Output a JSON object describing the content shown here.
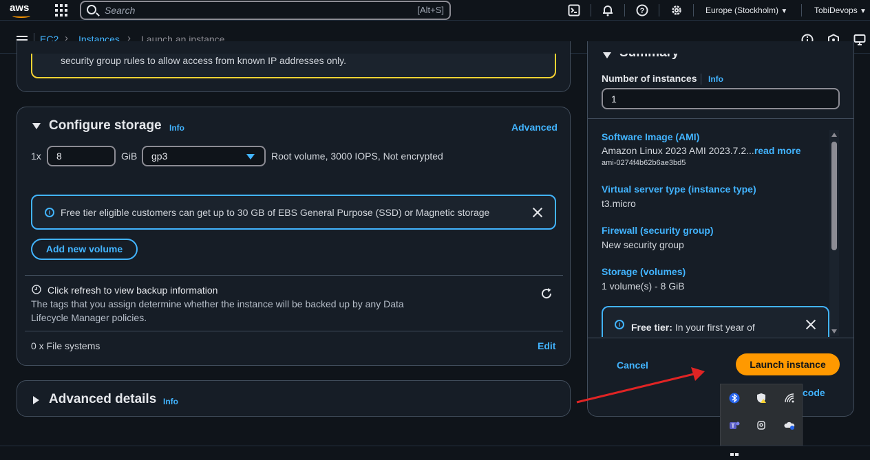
{
  "topbar": {
    "logo": "aws",
    "search_placeholder": "Search",
    "search_shortcut": "[Alt+S]",
    "region": "Europe (Stockholm)",
    "account": "TobiDevops",
    "icons": [
      "grid-icon",
      "cloudshell-icon",
      "bell-icon",
      "help-icon",
      "gear-icon"
    ]
  },
  "breadcrumb": {
    "items": [
      "EC2",
      "Instances"
    ],
    "current": "Launch an instance"
  },
  "network_warning": {
    "text": "security group rules to allow access from known IP addresses only."
  },
  "storage": {
    "title": "Configure storage",
    "info": "Info",
    "advanced": "Advanced",
    "multiplier": "1x",
    "size": "8",
    "unit": "GiB",
    "volume_type": "gp3",
    "details": "Root volume,  3000 IOPS,  Not encrypted",
    "alert": "Free tier eligible customers can get up to 30 GB of EBS General Purpose (SSD) or Magnetic storage",
    "add_volume": "Add new volume",
    "backup_title": "Click refresh to view backup information",
    "backup_desc_1": "The tags that you assign determine whether the instance will be backed up by any Data",
    "backup_desc_2": "Lifecycle Manager policies.",
    "file_systems": "0 x File systems",
    "edit": "Edit"
  },
  "advanced_details": {
    "title": "Advanced details",
    "info": "Info"
  },
  "summary": {
    "title": "Summary",
    "num_instances_label": "Number of instances",
    "info": "Info",
    "num_instances_value": "1",
    "ami_label": "Software Image (AMI)",
    "ami_value": "Amazon Linux 2023 AMI 2023.7.2...",
    "read_more": "read more",
    "ami_id": "ami-0274f4b62b6ae3bd5",
    "type_label": "Virtual server type (instance type)",
    "type_value": "t3.micro",
    "firewall_label": "Firewall (security group)",
    "firewall_value": "New security group",
    "storage_label": "Storage (volumes)",
    "storage_value": "1 volume(s) - 8 GiB",
    "freetier_label": "Free tier:",
    "freetier_text": "In your first year of",
    "cancel": "Cancel",
    "launch": "Launch instance",
    "preview_code": "code"
  },
  "colors": {
    "accent": "#42b4ff",
    "launch": "#ff9900",
    "warning": "#fbd332",
    "arrow": "#e02424"
  }
}
